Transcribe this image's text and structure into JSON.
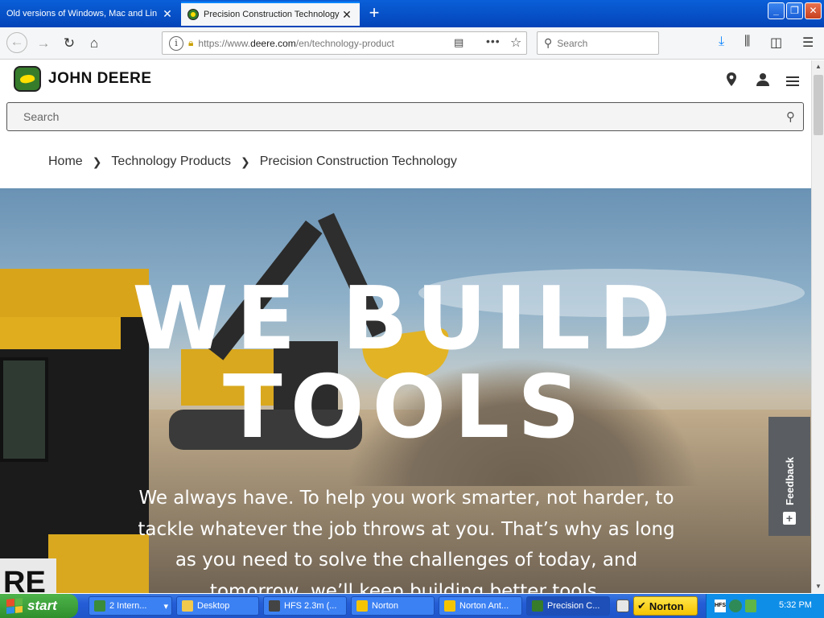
{
  "browser": {
    "tabs": [
      {
        "title": "Old versions of Windows, Mac and Lin",
        "active": false
      },
      {
        "title": "Precision Construction Technology",
        "active": true
      }
    ],
    "url_domain": "deere.com",
    "url_prefix": "https://www.",
    "url_suffix": "/en/technology-product",
    "search_placeholder": "Search"
  },
  "site": {
    "brand": "JOHN DEERE",
    "search_placeholder": "Search",
    "breadcrumb": [
      "Home",
      "Technology Products",
      "Precision Construction Technology"
    ],
    "hero": {
      "title_line1": "WE BUILD",
      "title_line2": "TOOLS",
      "subtitle": "We always have. To help you work smarter, not harder, to tackle whatever the job throws at you. That’s why as long as you need to solve the challenges of today, and tomorrow, we’ll keep building better tools.",
      "decal_text": "RE"
    },
    "feedback_label": "Feedback"
  },
  "taskbar": {
    "start_label": "start",
    "tasks": [
      {
        "label": "2 Intern...",
        "icon_color": "#3a8b3a"
      },
      {
        "label": "Desktop",
        "icon_color": "#f2c94c"
      },
      {
        "label": "HFS 2.3m (...",
        "icon_color": "#444444"
      },
      {
        "label": "Norton",
        "icon_color": "#f5c400"
      },
      {
        "label": "Norton Ant...",
        "icon_color": "#f5c400"
      },
      {
        "label": "Precision C...",
        "icon_color": "#367c2b"
      }
    ],
    "norton_label": "Norton",
    "clock": "5:32 PM"
  },
  "colors": {
    "jd_green": "#367c2b",
    "jd_yellow": "#ffde00",
    "xp_blue": "#245dd6",
    "start_green": "#3a9f37"
  }
}
